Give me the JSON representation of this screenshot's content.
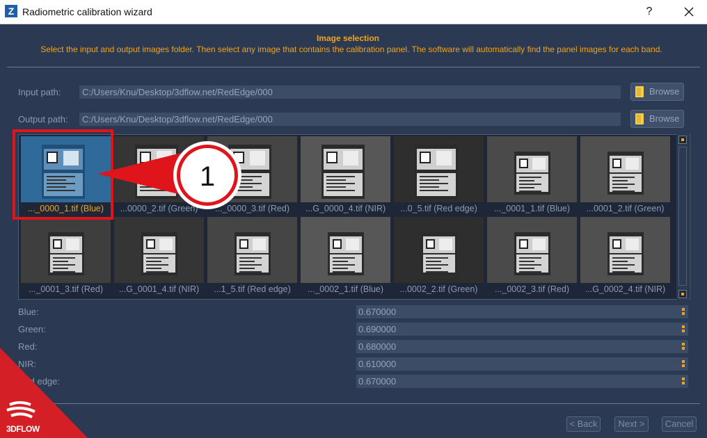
{
  "window": {
    "title": "Radiometric calibration wizard",
    "app_icon_letter": "Z",
    "help": "?",
    "close_icon": "close-icon"
  },
  "header": {
    "title": "Image selection",
    "description": "Select the input and output images folder. Then select any image that contains the calibration panel. The software will automatically find the panel images for each band."
  },
  "input_path": {
    "label": "Input path:",
    "value": "C:/Users/Knu/Desktop/3dflow.net/RedEdge/000",
    "browse": "Browse"
  },
  "output_path": {
    "label": "Output path:",
    "value": "C:/Users/Knu/Desktop/3dflow.net/RedEdge/000",
    "browse": "Browse"
  },
  "thumbnails": [
    {
      "label": "..._0000_1.tif (Blue)",
      "selected": true
    },
    {
      "label": "...0000_2.tif (Green)"
    },
    {
      "label": "..._0000_3.tif (Red)"
    },
    {
      "label": "...G_0000_4.tif (NIR)"
    },
    {
      "label": "...0_5.tif (Red edge)"
    },
    {
      "label": "..._0001_1.tif (Blue)"
    },
    {
      "label": "...0001_2.tif (Green)"
    },
    {
      "label": "..._0001_3.tif (Red)"
    },
    {
      "label": "...G_0001_4.tif (NIR)"
    },
    {
      "label": "...1_5.tif (Red edge)"
    },
    {
      "label": "..._0002_1.tif (Blue)"
    },
    {
      "label": "...0002_2.tif (Green)"
    },
    {
      "label": "..._0002_3.tif (Red)"
    },
    {
      "label": "...G_0002_4.tif (NIR)"
    }
  ],
  "bands": [
    {
      "label": "Blue:",
      "value": "0.670000"
    },
    {
      "label": "Green:",
      "value": "0.690000"
    },
    {
      "label": "Red:",
      "value": "0.680000"
    },
    {
      "label": "NIR:",
      "value": "0.610000"
    },
    {
      "label": "Red edge:",
      "value": "0.670000"
    }
  ],
  "buttons": {
    "back": "< Back",
    "next": "Next >",
    "cancel": "Cancel"
  },
  "callout": {
    "number": "1"
  },
  "logo": {
    "text": "3DFLOW"
  },
  "colors": {
    "accent": "#f2a416",
    "background": "#2b3a52",
    "callout_red": "#e0151b"
  }
}
